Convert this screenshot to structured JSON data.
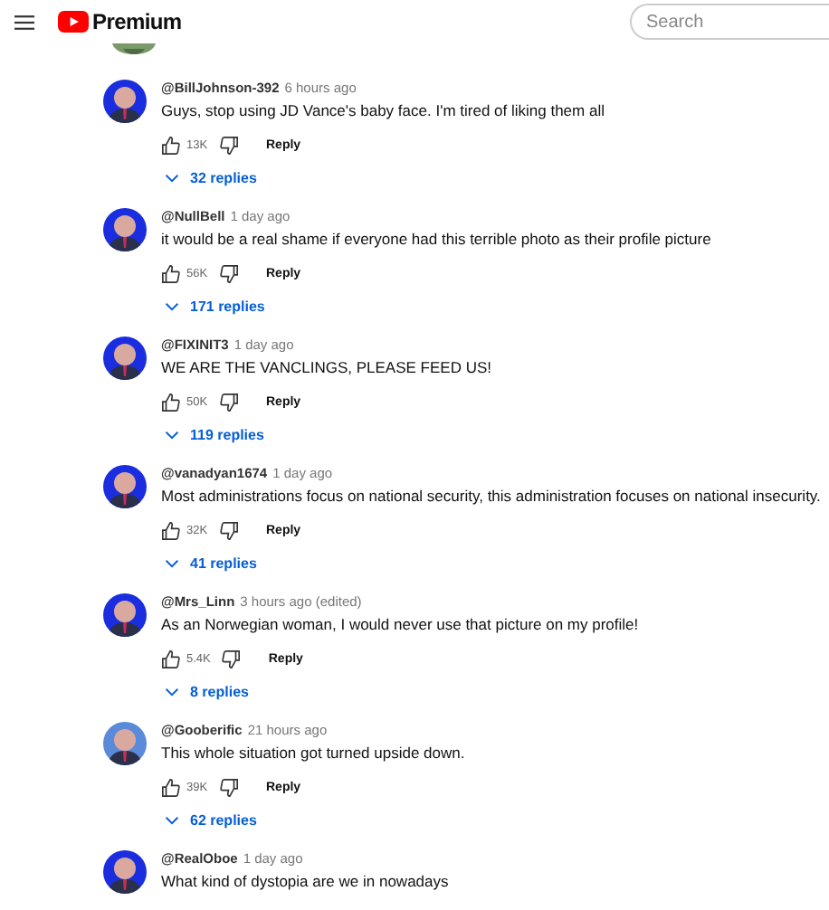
{
  "header": {
    "logo_text": "Premium",
    "search": {
      "placeholder": "Search"
    }
  },
  "comments": [
    {
      "author": "@BillJohnson-392",
      "time": "6 hours ago",
      "text": "Guys, stop using JD Vance's baby face. I'm tired of liking them all",
      "likes": "13K",
      "reply": "Reply",
      "replies": "32 replies"
    },
    {
      "author": "@NullBell",
      "time": "1 day ago",
      "text": "it would be a real shame if everyone had this terrible photo as their profile picture",
      "likes": "56K",
      "reply": "Reply",
      "replies": "171 replies"
    },
    {
      "author": "@FIXINIT3",
      "time": "1 day ago",
      "text": "WE ARE THE VANCLINGS, PLEASE FEED US!",
      "likes": "50K",
      "reply": "Reply",
      "replies": "119 replies"
    },
    {
      "author": "@vanadyan1674",
      "time": "1 day ago",
      "text": "Most administrations focus on national security, this administration focuses on national insecurity.",
      "likes": "32K",
      "reply": "Reply",
      "replies": "41 replies"
    },
    {
      "author": "@Mrs_Linn",
      "time": "3 hours ago (edited)",
      "text": "As an Norwegian woman, I would never use that picture on my profile!",
      "likes": "5.4K",
      "reply": "Reply",
      "replies": "8 replies"
    },
    {
      "author": "@Gooberific",
      "time": "21 hours ago",
      "text": "This whole situation got turned upside down.",
      "likes": "39K",
      "reply": "Reply",
      "replies": "62 replies"
    },
    {
      "author": "@RealOboe",
      "time": "1 day ago",
      "text": "What kind of dystopia are we in nowadays"
    }
  ]
}
